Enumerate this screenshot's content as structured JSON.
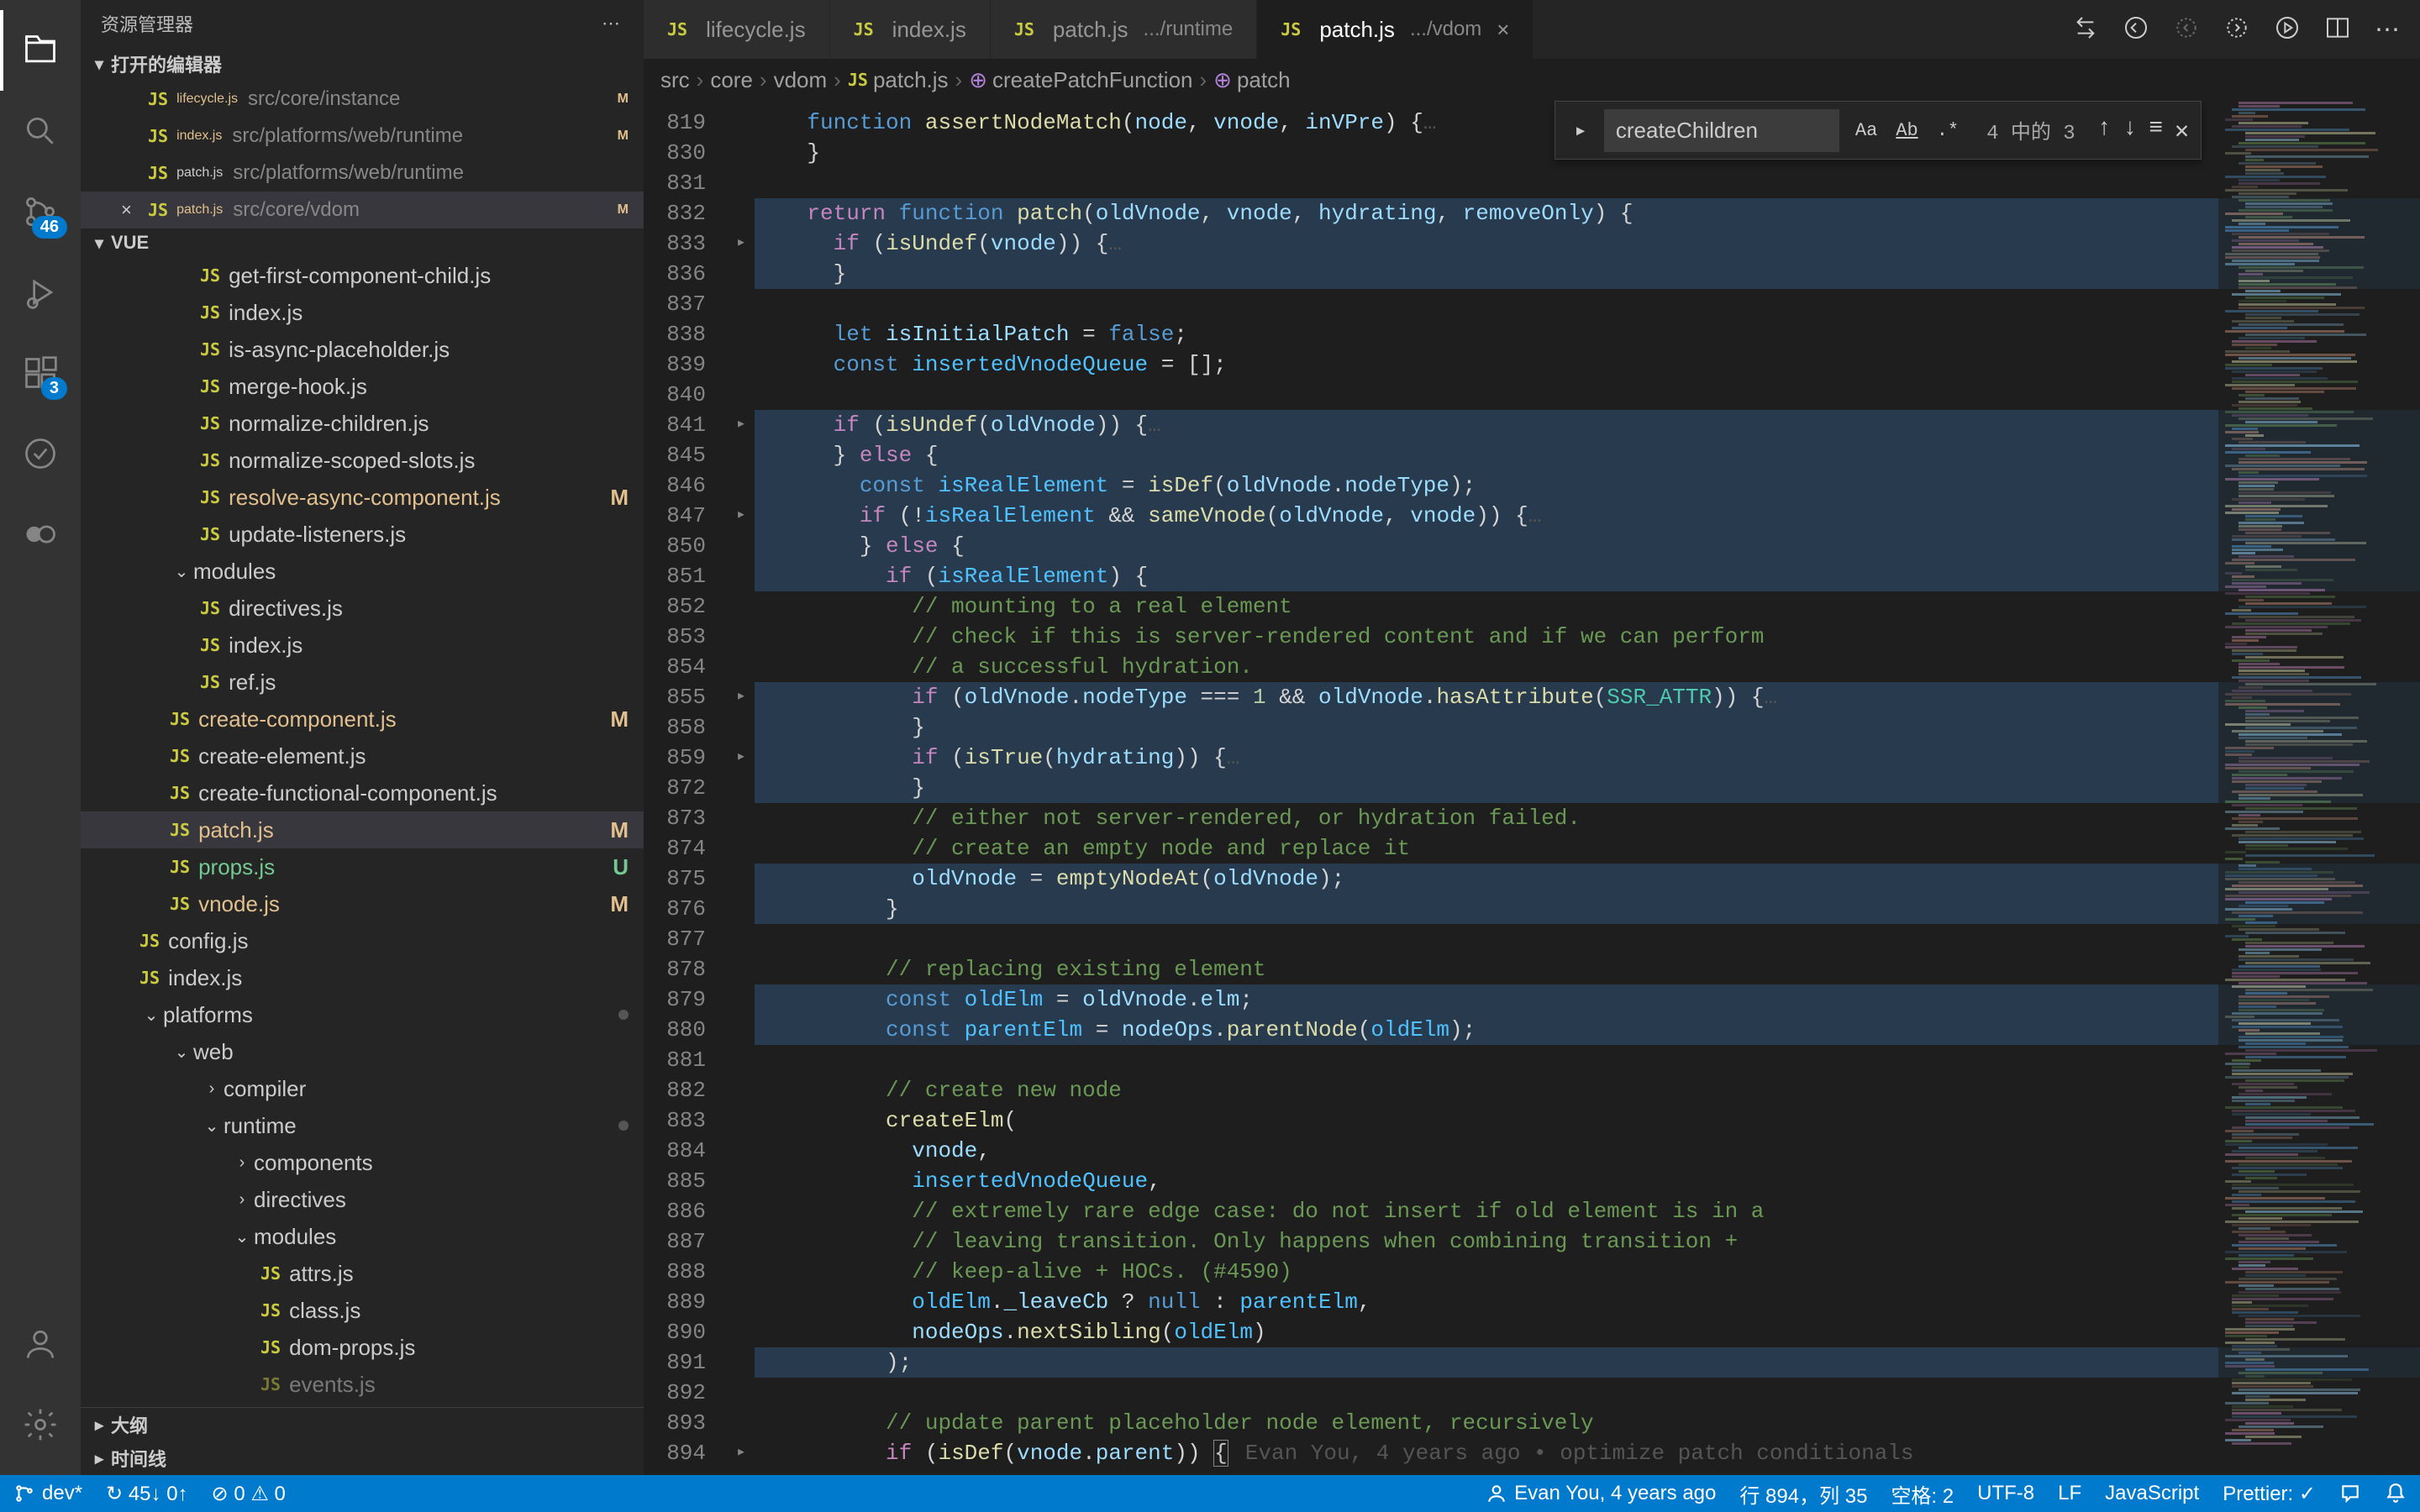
{
  "sidebar": {
    "title": "资源管理器",
    "open_editors": "打开的编辑器",
    "workspace": "VUE",
    "editors": [
      {
        "name": "lifecycle.js",
        "path": "src/core/instance",
        "gold": true,
        "m": "M"
      },
      {
        "name": "index.js",
        "path": "src/platforms/web/runtime",
        "gold": true,
        "m": "M"
      },
      {
        "name": "patch.js",
        "path": "src/platforms/web/runtime",
        "gold": false,
        "m": ""
      },
      {
        "name": "patch.js",
        "path": "src/core/vdom",
        "gold": true,
        "m": "M",
        "active": true,
        "close": true
      }
    ],
    "tree": [
      {
        "indent": 2,
        "icon": "js",
        "name": "get-first-component-child.js"
      },
      {
        "indent": 2,
        "icon": "js",
        "name": "index.js"
      },
      {
        "indent": 2,
        "icon": "js",
        "name": "is-async-placeholder.js"
      },
      {
        "indent": 2,
        "icon": "js",
        "name": "merge-hook.js"
      },
      {
        "indent": 2,
        "icon": "js",
        "name": "normalize-children.js"
      },
      {
        "indent": 2,
        "icon": "js",
        "name": "normalize-scoped-slots.js"
      },
      {
        "indent": 2,
        "icon": "js",
        "name": "resolve-async-component.js",
        "m": "M",
        "gold": true
      },
      {
        "indent": 2,
        "icon": "js",
        "name": "update-listeners.js"
      },
      {
        "indent": 1,
        "chev": "▾",
        "name": "modules"
      },
      {
        "indent": 2,
        "icon": "js",
        "name": "directives.js"
      },
      {
        "indent": 2,
        "icon": "js",
        "name": "index.js"
      },
      {
        "indent": 2,
        "icon": "js",
        "name": "ref.js"
      },
      {
        "indent": 1,
        "icon": "js",
        "name": "create-component.js",
        "m": "M",
        "gold": true
      },
      {
        "indent": 1,
        "icon": "js",
        "name": "create-element.js"
      },
      {
        "indent": 1,
        "icon": "js",
        "name": "create-functional-component.js"
      },
      {
        "indent": 1,
        "icon": "js",
        "name": "patch.js",
        "m": "M",
        "gold": true,
        "active": true
      },
      {
        "indent": 1,
        "icon": "js",
        "name": "props.js",
        "u": "U",
        "green": true
      },
      {
        "indent": 1,
        "icon": "js",
        "name": "vnode.js",
        "m": "M",
        "gold": true
      },
      {
        "indent": 0,
        "icon": "js",
        "name": "config.js"
      },
      {
        "indent": 0,
        "icon": "js",
        "name": "index.js"
      },
      {
        "indent": 0,
        "chev": "▾",
        "name": "platforms",
        "dot": true
      },
      {
        "indent": 1,
        "chev": "▾",
        "name": "web"
      },
      {
        "indent": 2,
        "chev": "▸",
        "name": "compiler"
      },
      {
        "indent": 2,
        "chev": "▾",
        "name": "runtime",
        "dot": true
      },
      {
        "indent": 3,
        "chev": "▸",
        "name": "components"
      },
      {
        "indent": 3,
        "chev": "▸",
        "name": "directives"
      },
      {
        "indent": 3,
        "chev": "▾",
        "name": "modules"
      },
      {
        "indent": 4,
        "icon": "js",
        "name": "attrs.js"
      },
      {
        "indent": 4,
        "icon": "js",
        "name": "class.js"
      },
      {
        "indent": 4,
        "icon": "js",
        "name": "dom-props.js"
      },
      {
        "indent": 4,
        "icon": "js",
        "name": "events.js",
        "cut": true
      }
    ],
    "outline": "大纲",
    "timeline": "时间线"
  },
  "tabs": [
    {
      "name": "lifecycle.js"
    },
    {
      "name": "index.js"
    },
    {
      "name": "patch.js",
      "suffix": ".../runtime"
    },
    {
      "name": "patch.js",
      "suffix": ".../vdom",
      "active": true,
      "close": true
    }
  ],
  "breadcrumbs": [
    "src",
    "core",
    "vdom",
    "patch.js",
    "createPatchFunction",
    "patch"
  ],
  "find": {
    "value": "createChildren",
    "count": "4 中的 3"
  },
  "activity": {
    "scm_badge": "46",
    "ext_badge": "3"
  },
  "lines_start": 819,
  "status": {
    "branch": "dev*",
    "sync": "↻ 45↓ 0↑",
    "problems": "⊘ 0 ⚠ 0",
    "blame": "Evan You, 4 years ago",
    "cursor": "行 894，列 35",
    "spaces": "空格: 2",
    "encoding": "UTF-8",
    "eol": "LF",
    "lang": "JavaScript",
    "prettier": "Prettier: ✓"
  },
  "code_blame": "Evan You, 4 years ago • optimize patch conditionals"
}
